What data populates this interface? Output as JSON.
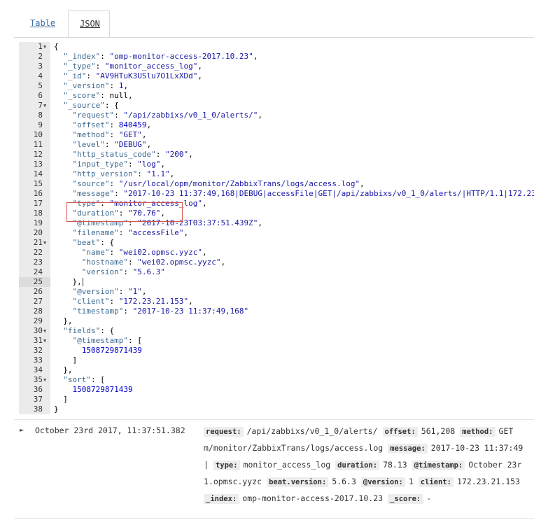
{
  "tabs": {
    "table_label": "Table",
    "json_label": "JSON"
  },
  "json_lines": [
    {
      "n": "1",
      "fold": true,
      "parts": [
        [
          "{",
          ""
        ]
      ]
    },
    {
      "n": "2",
      "parts": [
        [
          "  ",
          ""
        ],
        [
          "\"_index\"",
          "k"
        ],
        [
          ": ",
          ""
        ],
        [
          "\"omp-monitor-access-2017.10.23\"",
          "s"
        ],
        [
          ",",
          ""
        ]
      ]
    },
    {
      "n": "3",
      "parts": [
        [
          "  ",
          ""
        ],
        [
          "\"_type\"",
          "k"
        ],
        [
          ": ",
          ""
        ],
        [
          "\"monitor_access_log\"",
          "s"
        ],
        [
          ",",
          ""
        ]
      ]
    },
    {
      "n": "4",
      "parts": [
        [
          "  ",
          ""
        ],
        [
          "\"_id\"",
          "k"
        ],
        [
          ": ",
          ""
        ],
        [
          "\"AV9HTuK3USlu7O1LxXDd\"",
          "s"
        ],
        [
          ",",
          ""
        ]
      ]
    },
    {
      "n": "5",
      "parts": [
        [
          "  ",
          ""
        ],
        [
          "\"_version\"",
          "k"
        ],
        [
          ": ",
          ""
        ],
        [
          "1",
          "n"
        ],
        [
          ",",
          ""
        ]
      ]
    },
    {
      "n": "6",
      "parts": [
        [
          "  ",
          ""
        ],
        [
          "\"_score\"",
          "k"
        ],
        [
          ": null,",
          ""
        ]
      ]
    },
    {
      "n": "7",
      "fold": true,
      "parts": [
        [
          "  ",
          ""
        ],
        [
          "\"_source\"",
          "k"
        ],
        [
          ": {",
          ""
        ]
      ]
    },
    {
      "n": "8",
      "parts": [
        [
          "    ",
          ""
        ],
        [
          "\"request\"",
          "k"
        ],
        [
          ": ",
          ""
        ],
        [
          "\"/api/zabbixs/v0_1_0/alerts/\"",
          "s"
        ],
        [
          ",",
          ""
        ]
      ]
    },
    {
      "n": "9",
      "parts": [
        [
          "    ",
          ""
        ],
        [
          "\"offset\"",
          "k"
        ],
        [
          ": ",
          ""
        ],
        [
          "840459",
          "n"
        ],
        [
          ",",
          ""
        ]
      ]
    },
    {
      "n": "10",
      "parts": [
        [
          "    ",
          ""
        ],
        [
          "\"method\"",
          "k"
        ],
        [
          ": ",
          ""
        ],
        [
          "\"GET\"",
          "s"
        ],
        [
          ",",
          ""
        ]
      ]
    },
    {
      "n": "11",
      "parts": [
        [
          "    ",
          ""
        ],
        [
          "\"level\"",
          "k"
        ],
        [
          ": ",
          ""
        ],
        [
          "\"DEBUG\"",
          "s"
        ],
        [
          ",",
          ""
        ]
      ]
    },
    {
      "n": "12",
      "parts": [
        [
          "    ",
          ""
        ],
        [
          "\"http_status_code\"",
          "k"
        ],
        [
          ": ",
          ""
        ],
        [
          "\"200\"",
          "s"
        ],
        [
          ",",
          ""
        ]
      ]
    },
    {
      "n": "13",
      "parts": [
        [
          "    ",
          ""
        ],
        [
          "\"input_type\"",
          "k"
        ],
        [
          ": ",
          ""
        ],
        [
          "\"log\"",
          "s"
        ],
        [
          ",",
          ""
        ]
      ]
    },
    {
      "n": "14",
      "parts": [
        [
          "    ",
          ""
        ],
        [
          "\"http_version\"",
          "k"
        ],
        [
          ": ",
          ""
        ],
        [
          "\"1.1\"",
          "s"
        ],
        [
          ",",
          ""
        ]
      ]
    },
    {
      "n": "15",
      "parts": [
        [
          "    ",
          ""
        ],
        [
          "\"source\"",
          "k"
        ],
        [
          ": ",
          ""
        ],
        [
          "\"/usr/local/opm/monitor/ZabbixTrans/logs/access.log\"",
          "s"
        ],
        [
          ",",
          ""
        ]
      ]
    },
    {
      "n": "16",
      "parts": [
        [
          "    ",
          ""
        ],
        [
          "\"message\"",
          "k"
        ],
        [
          ": ",
          ""
        ],
        [
          "\"2017-10-23 11:37:49,168|DEBUG|accessFile|GET|/api/zabbixs/v0_1_0/alerts/|HTTP/1.1|172.23",
          "s"
        ]
      ]
    },
    {
      "n": "17",
      "parts": [
        [
          "    ",
          ""
        ],
        [
          "\"type\"",
          "k"
        ],
        [
          ": ",
          ""
        ],
        [
          "\"monitor_access_log\"",
          "s"
        ],
        [
          ",",
          ""
        ]
      ]
    },
    {
      "n": "18",
      "parts": [
        [
          "    ",
          ""
        ],
        [
          "\"duration\"",
          "k"
        ],
        [
          ": ",
          ""
        ],
        [
          "\"70.76\"",
          "s"
        ],
        [
          ",",
          ""
        ]
      ]
    },
    {
      "n": "19",
      "parts": [
        [
          "    ",
          ""
        ],
        [
          "\"@timestamp\"",
          "k"
        ],
        [
          ": ",
          ""
        ],
        [
          "\"2017-10-23T03:37:51.439Z\"",
          "s"
        ],
        [
          ",",
          ""
        ]
      ]
    },
    {
      "n": "20",
      "parts": [
        [
          "    ",
          ""
        ],
        [
          "\"filename\"",
          "k"
        ],
        [
          ": ",
          ""
        ],
        [
          "\"accessFile\"",
          "s"
        ],
        [
          ",",
          ""
        ]
      ]
    },
    {
      "n": "21",
      "fold": true,
      "parts": [
        [
          "    ",
          ""
        ],
        [
          "\"beat\"",
          "k"
        ],
        [
          ": {",
          ""
        ]
      ]
    },
    {
      "n": "22",
      "parts": [
        [
          "      ",
          ""
        ],
        [
          "\"name\"",
          "k"
        ],
        [
          ": ",
          ""
        ],
        [
          "\"wei02.opmsc.yyzc\"",
          "s"
        ],
        [
          ",",
          ""
        ]
      ]
    },
    {
      "n": "23",
      "parts": [
        [
          "      ",
          ""
        ],
        [
          "\"hostname\"",
          "k"
        ],
        [
          ": ",
          ""
        ],
        [
          "\"wei02.opmsc.yyzc\"",
          "s"
        ],
        [
          ",",
          ""
        ]
      ]
    },
    {
      "n": "24",
      "parts": [
        [
          "      ",
          ""
        ],
        [
          "\"version\"",
          "k"
        ],
        [
          ": ",
          ""
        ],
        [
          "\"5.6.3\"",
          "s"
        ]
      ]
    },
    {
      "n": "25",
      "active": true,
      "parts": [
        [
          "    },",
          ""
        ]
      ]
    },
    {
      "n": "26",
      "parts": [
        [
          "    ",
          ""
        ],
        [
          "\"@version\"",
          "k"
        ],
        [
          ": ",
          ""
        ],
        [
          "\"1\"",
          "s"
        ],
        [
          ",",
          ""
        ]
      ]
    },
    {
      "n": "27",
      "parts": [
        [
          "    ",
          ""
        ],
        [
          "\"client\"",
          "k"
        ],
        [
          ": ",
          ""
        ],
        [
          "\"172.23.21.153\"",
          "s"
        ],
        [
          ",",
          ""
        ]
      ]
    },
    {
      "n": "28",
      "parts": [
        [
          "    ",
          ""
        ],
        [
          "\"timestamp\"",
          "k"
        ],
        [
          ": ",
          ""
        ],
        [
          "\"2017-10-23 11:37:49,168\"",
          "s"
        ]
      ]
    },
    {
      "n": "29",
      "parts": [
        [
          "  },",
          ""
        ]
      ]
    },
    {
      "n": "30",
      "fold": true,
      "parts": [
        [
          "  ",
          ""
        ],
        [
          "\"fields\"",
          "k"
        ],
        [
          ": {",
          ""
        ]
      ]
    },
    {
      "n": "31",
      "fold": true,
      "parts": [
        [
          "    ",
          ""
        ],
        [
          "\"@timestamp\"",
          "k"
        ],
        [
          ": [",
          ""
        ]
      ]
    },
    {
      "n": "32",
      "parts": [
        [
          "      ",
          ""
        ],
        [
          "1508729871439",
          "n"
        ]
      ]
    },
    {
      "n": "33",
      "parts": [
        [
          "    ]",
          ""
        ]
      ]
    },
    {
      "n": "34",
      "parts": [
        [
          "  },",
          ""
        ]
      ]
    },
    {
      "n": "35",
      "fold": true,
      "parts": [
        [
          "  ",
          ""
        ],
        [
          "\"sort\"",
          "k"
        ],
        [
          ": [",
          ""
        ]
      ]
    },
    {
      "n": "36",
      "parts": [
        [
          "    ",
          ""
        ],
        [
          "1508729871439",
          "n"
        ]
      ]
    },
    {
      "n": "37",
      "parts": [
        [
          "  ]",
          ""
        ]
      ]
    },
    {
      "n": "38",
      "parts": [
        [
          "}",
          ""
        ]
      ]
    }
  ],
  "doc": {
    "time": "October 23rd 2017, 11:37:51.382",
    "summary_lines": [
      [
        [
          "request:",
          "/api/zabbixs/v0_1_0/alerts/"
        ],
        [
          "offset:",
          "561,208"
        ],
        [
          "method:",
          "GET"
        ]
      ],
      [
        [
          "",
          "m/monitor/ZabbixTrans/logs/access.log"
        ],
        [
          "message:",
          "2017-10-23 11:37:49"
        ]
      ],
      [
        [
          "",
          "|"
        ],
        [
          "type:",
          "monitor_access_log"
        ],
        [
          "duration:",
          "78.13"
        ],
        [
          "@timestamp:",
          "October 23r"
        ]
      ],
      [
        [
          "",
          "1.opmsc.yyzc"
        ],
        [
          "beat.version:",
          "5.6.3"
        ],
        [
          "@version:",
          "1"
        ],
        [
          "client:",
          "172.23.21.153"
        ]
      ],
      [
        [
          "_index:",
          "omp-monitor-access-2017.10.23"
        ],
        [
          "_score:",
          "-"
        ]
      ]
    ]
  }
}
